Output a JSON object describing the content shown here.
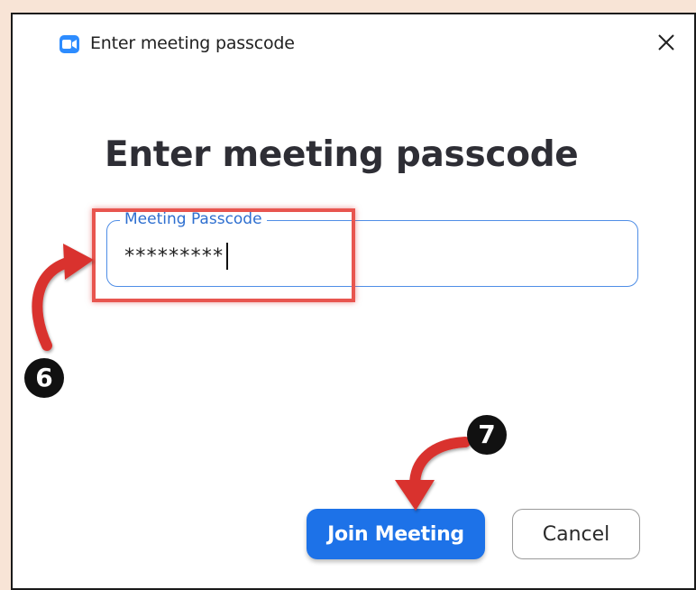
{
  "window": {
    "title": "Enter meeting passcode",
    "app_icon": "zoom-camera-icon",
    "close_icon": "close-icon"
  },
  "dialog": {
    "heading": "Enter meeting passcode",
    "passcode_field": {
      "label": "Meeting Passcode",
      "value": "*********"
    },
    "join_label": "Join Meeting",
    "cancel_label": "Cancel"
  },
  "annotations": {
    "step_6": "6",
    "step_7": "7"
  },
  "colors": {
    "accent": "#1d72e8",
    "field_border": "#4f8ee6",
    "annotation_red": "#e8554f"
  }
}
